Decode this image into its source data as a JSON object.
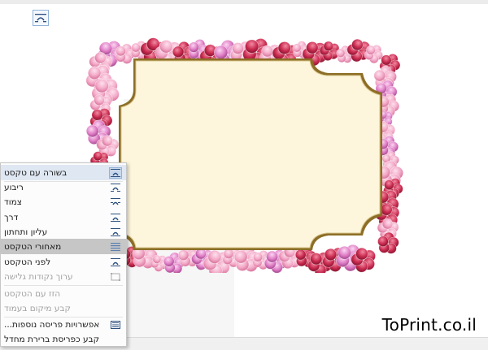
{
  "watermark": {
    "text": "ToPrint.co.il"
  },
  "toolbar": {
    "layout_icon": "wrap-text-icon"
  },
  "colors": {
    "frame_fill": "#fdf6dc",
    "frame_border": "#9a7d32",
    "flower_pink": "#f3a9c7",
    "flower_red": "#c92b4f",
    "menu_bg": "#fcfcfc",
    "menu_highlight": "#c6c6c6",
    "menu_checked": "#dfe7f2",
    "disabled_text": "#a3a3a3"
  },
  "menu": {
    "items": [
      {
        "label": "בשורה עם טקסט",
        "icon": "inline-with-text-icon",
        "state": "checked"
      },
      {
        "label": "ריבוע",
        "icon": "square-wrap-icon",
        "state": "normal"
      },
      {
        "label": "צמוד",
        "icon": "tight-wrap-icon",
        "state": "normal"
      },
      {
        "label": "דרך",
        "icon": "through-wrap-icon",
        "state": "normal"
      },
      {
        "label": "עליון ותחתון",
        "icon": "top-and-bottom-icon",
        "state": "normal"
      },
      {
        "label": "מאחורי הטקסט",
        "icon": "behind-text-icon",
        "state": "highlighted"
      },
      {
        "label": "לפני הטקסט",
        "icon": "in-front-of-text-icon",
        "state": "normal"
      },
      {
        "label": "ערוך נקודות גלישה",
        "icon": "edit-wrap-points-icon",
        "state": "disabled"
      },
      {
        "label": "הזז עם הטקסט",
        "icon": "",
        "state": "disabled"
      },
      {
        "label": "קבע מיקום בעמוד",
        "icon": "",
        "state": "disabled"
      },
      {
        "label": "אפשרויות פריסה נוספות...",
        "icon": "more-layout-options-icon",
        "state": "normal"
      },
      {
        "label": "קבע כפריסת ברירת מחדל",
        "icon": "",
        "state": "normal"
      }
    ]
  }
}
